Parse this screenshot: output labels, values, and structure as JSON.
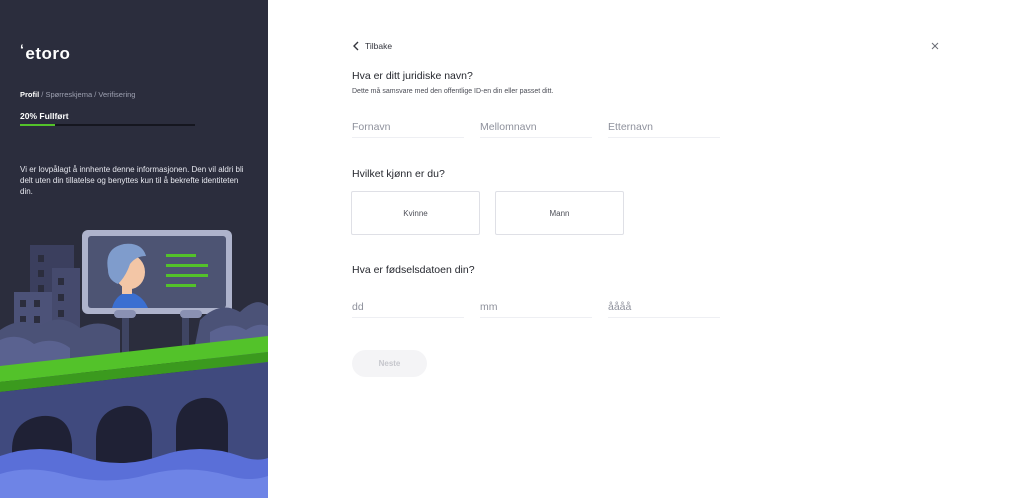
{
  "sidebar": {
    "logo": "etoro",
    "breadcrumb": {
      "current": "Profil",
      "separator": " / ",
      "rest": "Spørreskjema / Verifisering"
    },
    "progress": {
      "label": "20% Fullført",
      "value": 0.2
    },
    "info": "Vi er lovpålagt å innhente denne informasjonen. Den vil aldri bli delt uten din tillatelse og benyttes kun til å bekrefte identiteten din."
  },
  "header": {
    "back_label": "Tilbake"
  },
  "name_section": {
    "title": "Hva er ditt juridiske navn?",
    "subtitle": "Dette må samsvare med den offentlige ID-en din eller passet ditt.",
    "first_placeholder": "Fornavn",
    "middle_placeholder": "Mellomnavn",
    "last_placeholder": "Etternavn"
  },
  "gender_section": {
    "title": "Hvilket kjønn er du?",
    "options": [
      "Kvinne",
      "Mann"
    ]
  },
  "dob_section": {
    "title": "Hva er fødselsdatoen din?",
    "day_placeholder": "dd",
    "month_placeholder": "mm",
    "year_placeholder": "åååå"
  },
  "next_label": "Neste",
  "colors": {
    "accent_green": "#53c22a",
    "sidebar_bg": "#2b2d3d"
  }
}
